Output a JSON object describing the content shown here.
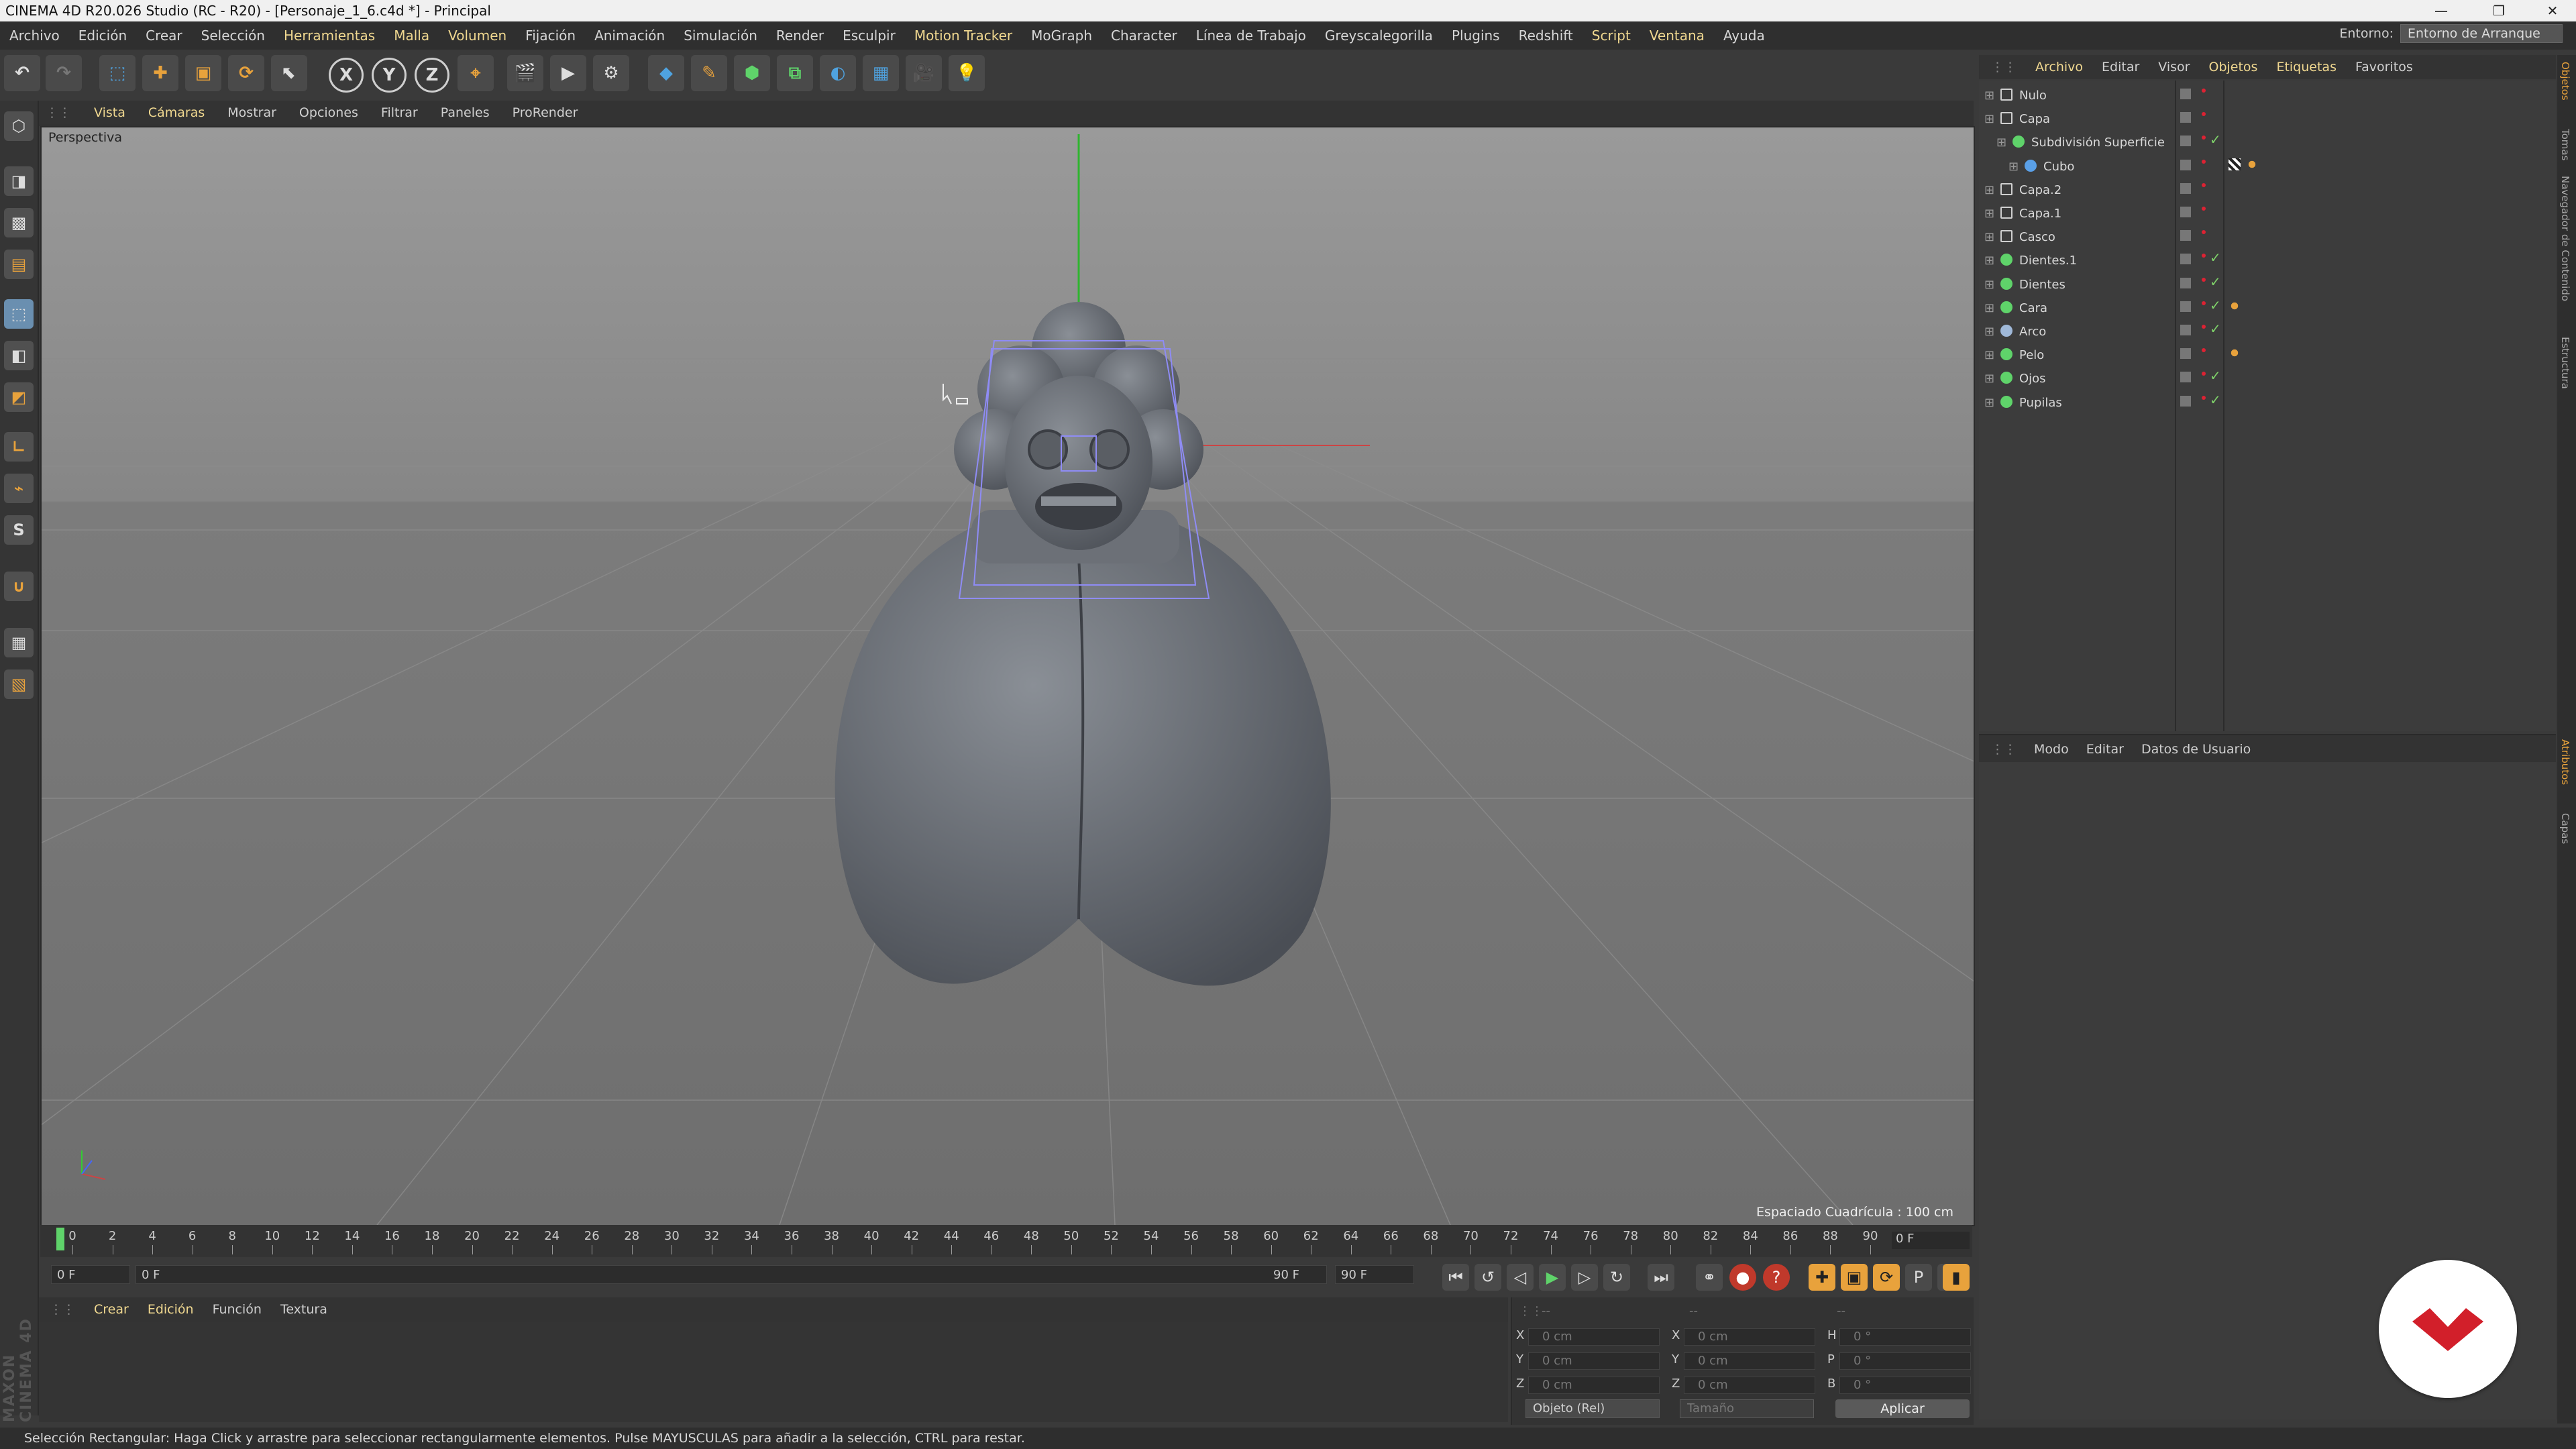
{
  "window": {
    "title": "CINEMA 4D R20.026 Studio (RC - R20) - [Personaje_1_6.c4d *] - Principal"
  },
  "menu": {
    "items": [
      "Archivo",
      "Edición",
      "Crear",
      "Selección",
      "Herramientas",
      "Malla",
      "Volumen",
      "Fijación",
      "Animación",
      "Simulación",
      "Render",
      "Esculpir",
      "Motion Tracker",
      "MoGraph",
      "Character",
      "Línea de Trabajo",
      "Greyscalegorilla",
      "Plugins",
      "Redshift",
      "Script",
      "Ventana",
      "Ayuda"
    ],
    "entorno_label": "Entorno:",
    "entorno_value": "Entorno de Arranque"
  },
  "toolbar": {
    "axis_x": "X",
    "axis_y": "Y",
    "axis_z": "Z"
  },
  "viewport": {
    "menu": [
      "Vista",
      "Cámaras",
      "Mostrar",
      "Opciones",
      "Filtrar",
      "Paneles",
      "ProRender"
    ],
    "label": "Perspectiva",
    "grid_spacing": "Espaciado Cuadrícula : 100 cm"
  },
  "timeline": {
    "ticks": [
      "0",
      "2",
      "4",
      "6",
      "8",
      "10",
      "12",
      "14",
      "16",
      "18",
      "20",
      "22",
      "24",
      "26",
      "28",
      "30",
      "32",
      "34",
      "36",
      "38",
      "40",
      "42",
      "44",
      "46",
      "48",
      "50",
      "52",
      "54",
      "56",
      "58",
      "60",
      "62",
      "64",
      "66",
      "68",
      "70",
      "72",
      "74",
      "76",
      "78",
      "80",
      "82",
      "84",
      "86",
      "88",
      "90"
    ],
    "current_frame": "0 F",
    "start_frame": "0 F",
    "range_start": "0 F",
    "range_end": "90 F",
    "end_frame": "90 F"
  },
  "material_manager": {
    "menu": [
      "Crear",
      "Edición",
      "Función",
      "Textura"
    ]
  },
  "coordinates": {
    "pos": [
      {
        "axis": "X",
        "value": "0 cm"
      },
      {
        "axis": "Y",
        "value": "0 cm"
      },
      {
        "axis": "Z",
        "value": "0 cm"
      }
    ],
    "size": [
      {
        "axis": "X",
        "value": "0 cm"
      },
      {
        "axis": "Y",
        "value": "0 cm"
      },
      {
        "axis": "Z",
        "value": "0 cm"
      }
    ],
    "rot": [
      {
        "axis": "H",
        "value": "0 °"
      },
      {
        "axis": "P",
        "value": "0 °"
      },
      {
        "axis": "B",
        "value": "0 °"
      }
    ],
    "mode": "Objeto (Rel)",
    "size_mode": "Tamaño",
    "apply": "Aplicar"
  },
  "object_manager": {
    "menu": [
      "Archivo",
      "Editar",
      "Visor",
      "Objetos",
      "Etiquetas",
      "Favoritos"
    ],
    "objects": [
      {
        "name": "Nulo",
        "indent": 0,
        "icon": "null-icon",
        "check": false,
        "tag": ""
      },
      {
        "name": "Capa",
        "indent": 0,
        "icon": "null-icon",
        "check": false,
        "tag": ""
      },
      {
        "name": "Subdivisión Superficie",
        "indent": 1,
        "icon": "subdivision-icon",
        "check": true,
        "tag": ""
      },
      {
        "name": "Cubo",
        "indent": 2,
        "icon": "cube-icon",
        "check": false,
        "tag": "texture"
      },
      {
        "name": "Capa.2",
        "indent": 0,
        "icon": "null-icon",
        "check": false,
        "tag": ""
      },
      {
        "name": "Capa.1",
        "indent": 0,
        "icon": "null-icon",
        "check": false,
        "tag": ""
      },
      {
        "name": "Casco",
        "indent": 0,
        "icon": "null-icon",
        "check": false,
        "tag": ""
      },
      {
        "name": "Dientes.1",
        "indent": 0,
        "icon": "subdivision-icon",
        "check": true,
        "tag": ""
      },
      {
        "name": "Dientes",
        "indent": 0,
        "icon": "subdivision-icon",
        "check": true,
        "tag": ""
      },
      {
        "name": "Cara",
        "indent": 0,
        "icon": "symmetry-icon",
        "check": true,
        "tag": "material"
      },
      {
        "name": "Arco",
        "indent": 0,
        "icon": "spline-icon",
        "check": true,
        "tag": ""
      },
      {
        "name": "Pelo",
        "indent": 0,
        "icon": "symmetry-icon",
        "check": false,
        "tag": "material"
      },
      {
        "name": "Ojos",
        "indent": 0,
        "icon": "subdivision-icon",
        "check": true,
        "tag": ""
      },
      {
        "name": "Pupilas",
        "indent": 0,
        "icon": "subdivision-icon",
        "check": true,
        "tag": ""
      }
    ]
  },
  "attributes": {
    "menu": [
      "Modo",
      "Editar",
      "Datos de Usuario"
    ]
  },
  "right_tabs": [
    "Objetos",
    "Tomas",
    "Navegador de Contenido",
    "Estructura",
    "Atributos",
    "Capas"
  ],
  "status": "Selección Rectangular: Haga Click y arrastre para seleccionar rectangularmente elementos. Pulse MAYUSCULAS para añadir a la selección, CTRL para restar.",
  "maxon_logo": "MAXON CINEMA 4D",
  "colors": {
    "accent": "#f0d890",
    "active_orange": "#e8a23c",
    "viewport_bg": "#7c7c7c"
  }
}
